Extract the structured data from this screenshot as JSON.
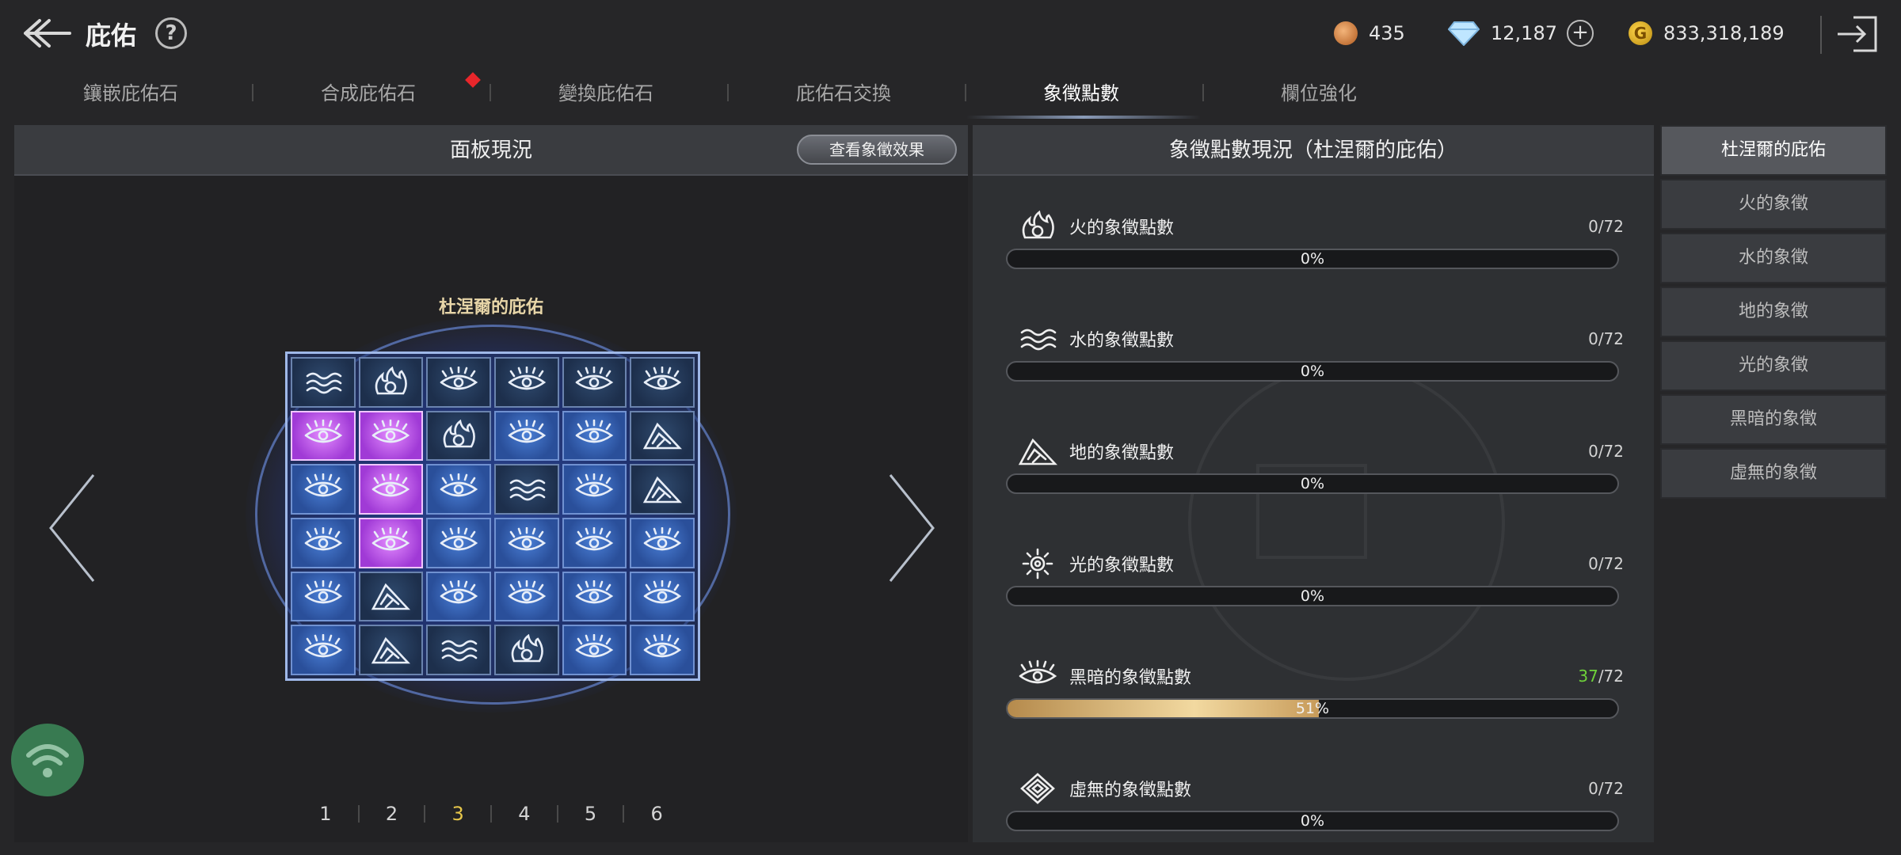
{
  "header": {
    "title": "庇佑",
    "help_label": "?",
    "currencies": {
      "stone": "435",
      "gem": "12,187",
      "gem_plus": "+",
      "gold": "833,318,189",
      "gold_symbol": "G"
    }
  },
  "tabs": [
    "鑲嵌庇佑石",
    "合成庇佑石",
    "變換庇佑石",
    "庇佑石交換",
    "象徵點數",
    "欄位強化"
  ],
  "active_tab": "象徵點數",
  "board_panel": {
    "title": "面板現況",
    "effect_button": "查看象徵效果",
    "board_title": "杜涅爾的庇佑",
    "cells": [
      [
        "water",
        "fire",
        "dark",
        "dark",
        "dark",
        "dark"
      ],
      [
        "dark",
        "dark",
        "fire",
        "dark",
        "dark",
        "earth"
      ],
      [
        "dark",
        "dark",
        "dark",
        "water",
        "dark",
        "earth"
      ],
      [
        "dark",
        "dark",
        "dark",
        "dark",
        "dark",
        "dark"
      ],
      [
        "dark",
        "earth",
        "dark",
        "dark",
        "dark",
        "dark"
      ],
      [
        "dark",
        "earth",
        "water",
        "fire",
        "dark",
        "dark"
      ]
    ],
    "pages": [
      "1",
      "2",
      "3",
      "4",
      "5",
      "6"
    ],
    "active_page": "3"
  },
  "symbol_panel": {
    "title": "象徵點數現況（杜涅爾的庇佑）",
    "symbols": [
      {
        "icon": "fire-symbol-icon",
        "name": "火的象徵點數",
        "current": "0",
        "max": "/72",
        "percent": 0,
        "percent_label": "0%"
      },
      {
        "icon": "water-symbol-icon",
        "name": "水的象徵點數",
        "current": "0",
        "max": "/72",
        "percent": 0,
        "percent_label": "0%"
      },
      {
        "icon": "earth-symbol-icon",
        "name": "地的象徵點數",
        "current": "0",
        "max": "/72",
        "percent": 0,
        "percent_label": "0%"
      },
      {
        "icon": "light-symbol-icon",
        "name": "光的象徵點數",
        "current": "0",
        "max": "/72",
        "percent": 0,
        "percent_label": "0%"
      },
      {
        "icon": "dark-symbol-icon",
        "name": "黑暗的象徵點數",
        "current": "37",
        "max": "/72",
        "percent": 51,
        "percent_label": "51%"
      },
      {
        "icon": "void-symbol-icon",
        "name": "虛無的象徵點數",
        "current": "0",
        "max": "/72",
        "percent": 0,
        "percent_label": "0%"
      }
    ]
  },
  "side_list": {
    "items": [
      "杜涅爾的庇佑",
      "火的象徵",
      "水的象徵",
      "地的象徵",
      "光的象徵",
      "黑暗的象徵",
      "虛無的象徵"
    ],
    "active": "杜涅爾的庇佑"
  },
  "colors": {
    "accent_gold": "#e6c64a",
    "progress_fill": "#f2d9a0",
    "green_value": "#6ed13a",
    "notice_red": "#e8262b"
  }
}
